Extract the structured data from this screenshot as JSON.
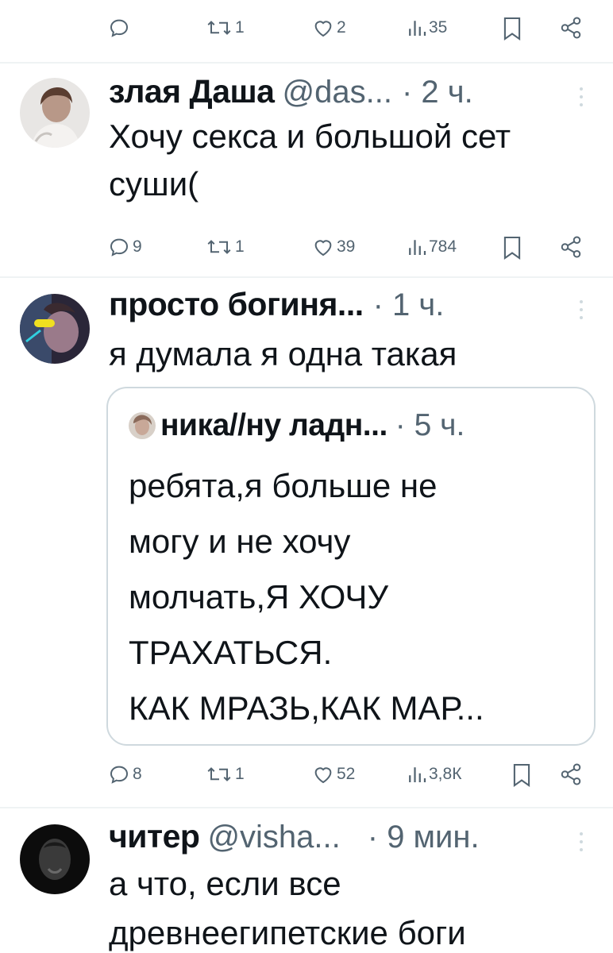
{
  "top_actions": {
    "reply": "",
    "retweets": "1",
    "likes": "2",
    "views": "35"
  },
  "tweets": [
    {
      "name": "злая Даша",
      "handle": "@das...",
      "time": "· 2 ч.",
      "text": "Хочу секса и большой сет суши(",
      "actions": {
        "replies": "9",
        "retweets": "1",
        "likes": "39",
        "views": "784"
      }
    },
    {
      "name": "просто богиня...",
      "handle": "",
      "time": "· 1 ч.",
      "text": "я думала я одна такая",
      "quote": {
        "name": "ника//ну ладн...",
        "time": "· 5 ч.",
        "text": "ребята,я больше не\nмогу и не хочу\nмолчать,Я ХОЧУ\nТРАХАТЬСЯ.\nКАК МРАЗЬ,КАК МАР..."
      },
      "actions": {
        "replies": "8",
        "retweets": "1",
        "likes": "52",
        "views": "3,8К"
      }
    },
    {
      "name": "читер",
      "handle": "@visha...",
      "time": "· 9 мин.",
      "text": "а что, если все древнеегипетские боги"
    }
  ],
  "colors": {
    "text": "#0f1419",
    "secondary": "#536471",
    "border": "#cfd9de",
    "divider": "#eff3f4"
  }
}
